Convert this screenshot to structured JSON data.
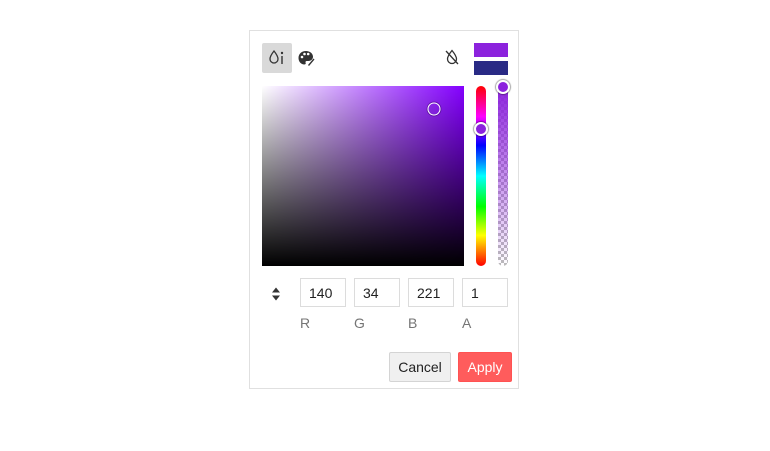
{
  "picker": {
    "modes": [
      {
        "name": "picker",
        "icon": "color-picker-icon",
        "active": true
      },
      {
        "name": "palette",
        "icon": "palette-icon",
        "active": false
      }
    ],
    "no_color_icon": "no-color-icon",
    "current_color": "#8c22dd",
    "previous_color": "#292a85",
    "hue_color": "#8400ff",
    "hue_level": 0.24,
    "alpha_level": 0.0,
    "sv_saturation": 0.85,
    "sv_value": 0.87,
    "format_icon": "sort-arrows-icon",
    "rgba": {
      "r": "140",
      "g": "34",
      "b": "221",
      "a": "1"
    },
    "labels": {
      "r": "R",
      "g": "G",
      "b": "B",
      "a": "A"
    },
    "buttons": {
      "cancel": "Cancel",
      "apply": "Apply"
    },
    "colors": {
      "apply_bg": "#ff5c5c",
      "handle_purple": "#8c22dd"
    }
  }
}
